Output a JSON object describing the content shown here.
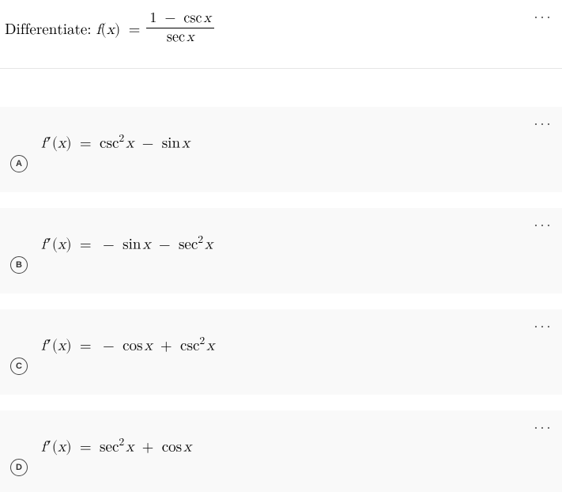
{
  "question": {
    "prompt": "Differentiate:",
    "lhs_html": "<span class='mi'>f</span>(<span class='mi'>x</span>) <span class='op'>=</span>",
    "numerator_html": "1 <span class='op'>−</span> <span class='fn'>csc</span><span class='thin'></span><span class='mi'>x</span>",
    "denominator_html": "<span class='fn'>sec</span><span class='thin'></span><span class='mi'>x</span>",
    "more_glyph": "···"
  },
  "answers": [
    {
      "letter": "A",
      "expr_html": "<span class='mi'>f</span><span class='prime'>′</span>(<span class='mi'>x</span>) <span class='op'>=</span> <span class='fn'>csc</span><span class='sup'>2</span><span class='thin'></span><span class='mi'>x</span> <span class='op'>−</span> <span class='fn'>sin</span><span class='thin'></span><span class='mi'>x</span>",
      "more_glyph": "···"
    },
    {
      "letter": "B",
      "expr_html": "<span class='mi'>f</span><span class='prime'>′</span>(<span class='mi'>x</span>) <span class='op'>=</span> <span class='op'>−</span> <span class='fn'>sin</span><span class='thin'></span><span class='mi'>x</span> <span class='op'>−</span> <span class='fn'>sec</span><span class='sup'>2</span><span class='thin'></span><span class='mi'>x</span>",
      "more_glyph": "···"
    },
    {
      "letter": "C",
      "expr_html": "<span class='mi'>f</span><span class='prime'>′</span>(<span class='mi'>x</span>) <span class='op'>=</span> <span class='op'>−</span> <span class='fn'>cos</span><span class='thin'></span><span class='mi'>x</span> <span class='op'>+</span> <span class='fn'>csc</span><span class='sup'>2</span><span class='thin'></span><span class='mi'>x</span>",
      "more_glyph": "···"
    },
    {
      "letter": "D",
      "expr_html": "<span class='mi'>f</span><span class='prime'>′</span>(<span class='mi'>x</span>) <span class='op'>=</span> <span class='fn'>sec</span><span class='sup'>2</span><span class='thin'></span><span class='mi'>x</span> <span class='op'>+</span> <span class='fn'>cos</span><span class='thin'></span><span class='mi'>x</span>",
      "more_glyph": "···"
    }
  ]
}
